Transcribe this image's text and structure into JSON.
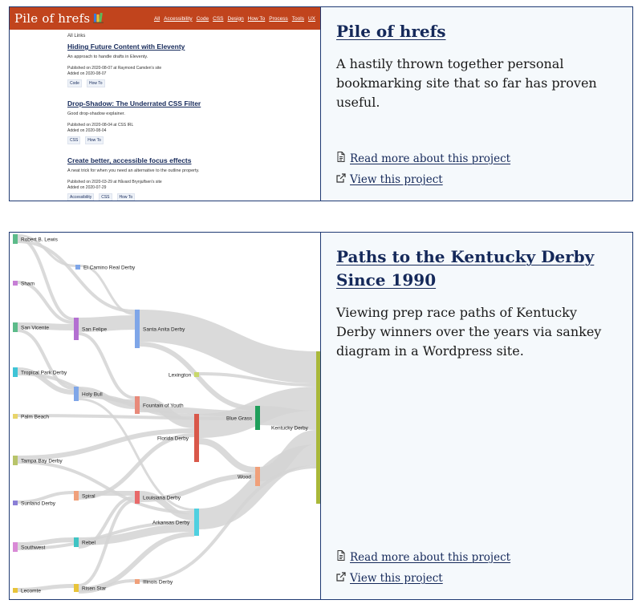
{
  "projects": [
    {
      "title": "Pile of hrefs",
      "description": "A hastily thrown together personal bookmarking site that so far has proven useful.",
      "read_more": "Read more about this project",
      "view": "View this project",
      "thumbnail": {
        "logo": "Pile of hrefs",
        "nav": [
          "All",
          "Accessibility",
          "Code",
          "CSS",
          "Design",
          "How To",
          "Process",
          "Tools",
          "UX"
        ],
        "heading": "All Links",
        "entries": [
          {
            "title": "Hiding Future Content with Eleventy",
            "description": "An approach to handle drafts in Eleventy.",
            "published": "Published on 2020-08-07 at Raymond Camden's site",
            "added": "Added on 2020-08-07",
            "tags": [
              "Code",
              "How To"
            ]
          },
          {
            "title": "Drop-Shadow: The Underrated CSS Filter",
            "description": "Good drop-shadow explainer.",
            "published": "Published on 2020-08-04 at CSS IRL",
            "added": "Added on 2020-08-04",
            "tags": [
              "CSS",
              "How To"
            ]
          },
          {
            "title": "Create better, accessible focus effects",
            "description": "A neat trick for when you need an alternative to the outline property.",
            "published": "Published on 2020-03-29 at Håvard Brynjulfsen's site",
            "added": "Added on 2020-07-29",
            "tags": [
              "Accessibility",
              "CSS",
              "How To"
            ]
          }
        ]
      }
    },
    {
      "title": "Paths to the Kentucky Derby Since 1990",
      "description": "Viewing prep race paths of Kentucky Derby winners over the years via sankey diagram in a Wordpress site.",
      "read_more": "Read more about this project",
      "view": "View this project",
      "thumbnail": {
        "nodes": [
          {
            "id": "robert",
            "label": "Robert B. Lewis",
            "color": "#5dbb8a"
          },
          {
            "id": "elcamino",
            "label": "El Camino Real Derby",
            "color": "#7fa6e8"
          },
          {
            "id": "sham",
            "label": "Sham",
            "color": "#c77fd6"
          },
          {
            "id": "sanvicente",
            "label": "San Vicente",
            "color": "#5dbb8a"
          },
          {
            "id": "sanfelipe",
            "label": "San Felipe",
            "color": "#b36fd1"
          },
          {
            "id": "santaanita",
            "label": "Santa Anita Derby",
            "color": "#7fa6e8"
          },
          {
            "id": "lexington",
            "label": "Lexington",
            "color": "#c8d86a"
          },
          {
            "id": "tropical",
            "label": "Tropical Park Derby",
            "color": "#3fc4d6"
          },
          {
            "id": "holybull",
            "label": "Holy Bull",
            "color": "#7fa6e8"
          },
          {
            "id": "fountain",
            "label": "Fountain of Youth",
            "color": "#e88a7a"
          },
          {
            "id": "palmbeach",
            "label": "Palm Beach",
            "color": "#e8d46a"
          },
          {
            "id": "bluegrass",
            "label": "Blue Grass",
            "color": "#1f9e5a"
          },
          {
            "id": "kentucky",
            "label": "Kentucky Derby",
            "color": "#a9b83a"
          },
          {
            "id": "florida",
            "label": "Florida Derby",
            "color": "#d9584a"
          },
          {
            "id": "tampabay",
            "label": "Tampa Bay Derby",
            "color": "#b8c46a"
          },
          {
            "id": "wood",
            "label": "Wood",
            "color": "#f0a07a"
          },
          {
            "id": "spiral",
            "label": "Spiral",
            "color": "#f0a07a"
          },
          {
            "id": "sunland",
            "label": "Sunland Derby",
            "color": "#8a7fd6"
          },
          {
            "id": "louisiana",
            "label": "Louisiana Derby",
            "color": "#e86a6a"
          },
          {
            "id": "arkansas",
            "label": "Arkansas Derby",
            "color": "#4fd0e0"
          },
          {
            "id": "southwest",
            "label": "Southwest",
            "color": "#d98ad6"
          },
          {
            "id": "rebel",
            "label": "Rebel",
            "color": "#3fc4c4"
          },
          {
            "id": "illinois",
            "label": "Illinois Derby",
            "color": "#f0a07a"
          },
          {
            "id": "lecomte",
            "label": "Lecomte",
            "color": "#e8c43a"
          },
          {
            "id": "risenstar",
            "label": "Risen Star",
            "color": "#e8c43a"
          }
        ]
      }
    }
  ],
  "icons": {
    "read_more": "document-icon",
    "view": "external-link-icon"
  },
  "colors": {
    "title": "#15295a",
    "border": "#1f3a73",
    "info_bg": "#f5f9fc",
    "header_bg": "#c1441d"
  }
}
